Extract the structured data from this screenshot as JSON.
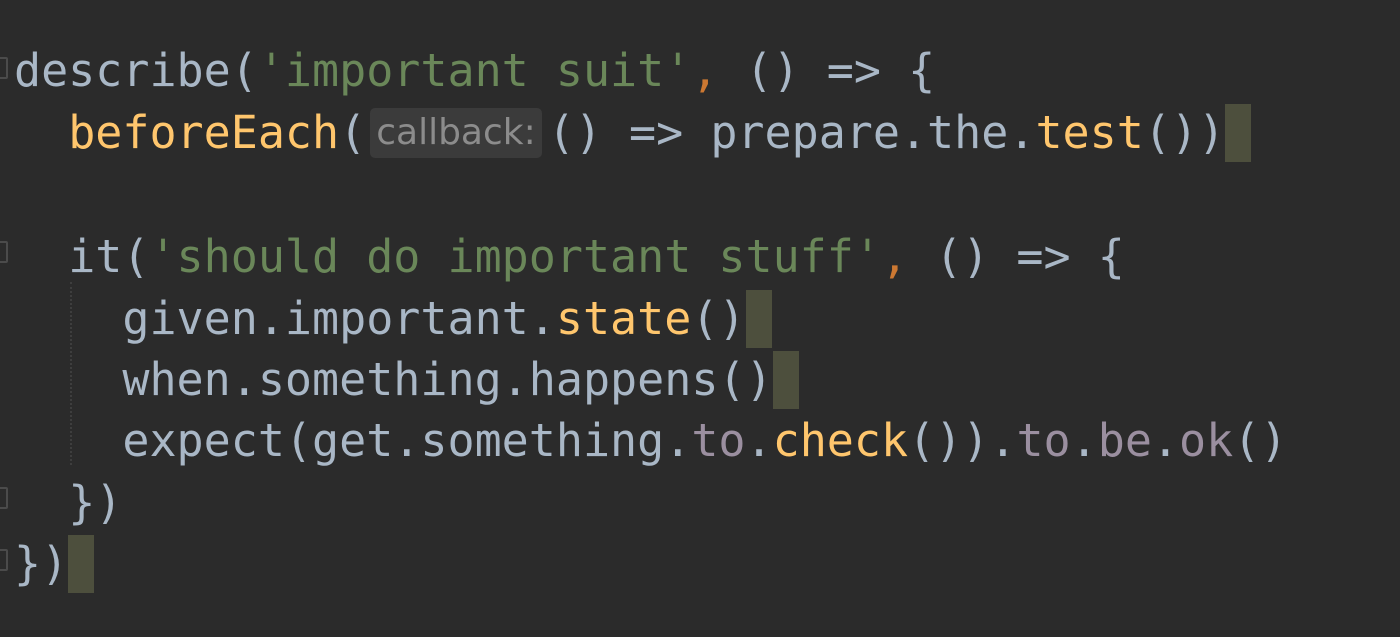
{
  "editor": {
    "lines": {
      "l1": {
        "a": "describe(",
        "b": "'important suit'",
        "c": ",",
        "d": " () => {"
      },
      "l2": {
        "indent": "  ",
        "a": "beforeEach",
        "b": "(",
        "hint": "callback:",
        "c": "() => prepare.the.",
        "d": "test",
        "e": "())"
      },
      "l4": {
        "indent": "  ",
        "a": "it(",
        "b": "'should do important stuff'",
        "c": ",",
        "d": " () => {"
      },
      "l5": {
        "indent": "    ",
        "a": "given.important.",
        "b": "state",
        "c": "()"
      },
      "l6": {
        "indent": "    ",
        "a": "when.something.happens()"
      },
      "l7": {
        "indent": "    ",
        "a": "expect(get.something.",
        "b": "to",
        "c": ".",
        "d": "check",
        "e": "()).",
        "f": "to",
        "g": ".",
        "h": "be",
        "i": ".",
        "j": "ok",
        "k": "()"
      },
      "l8": {
        "indent": "  ",
        "a": "})"
      },
      "l9": {
        "a": "})"
      }
    },
    "colors": {
      "background": "#2b2b2b",
      "text": "#a9b7c6",
      "string": "#6a8759",
      "function": "#ffc66d",
      "comma": "#cc7832",
      "dimmed": "#9b8fa0"
    }
  }
}
